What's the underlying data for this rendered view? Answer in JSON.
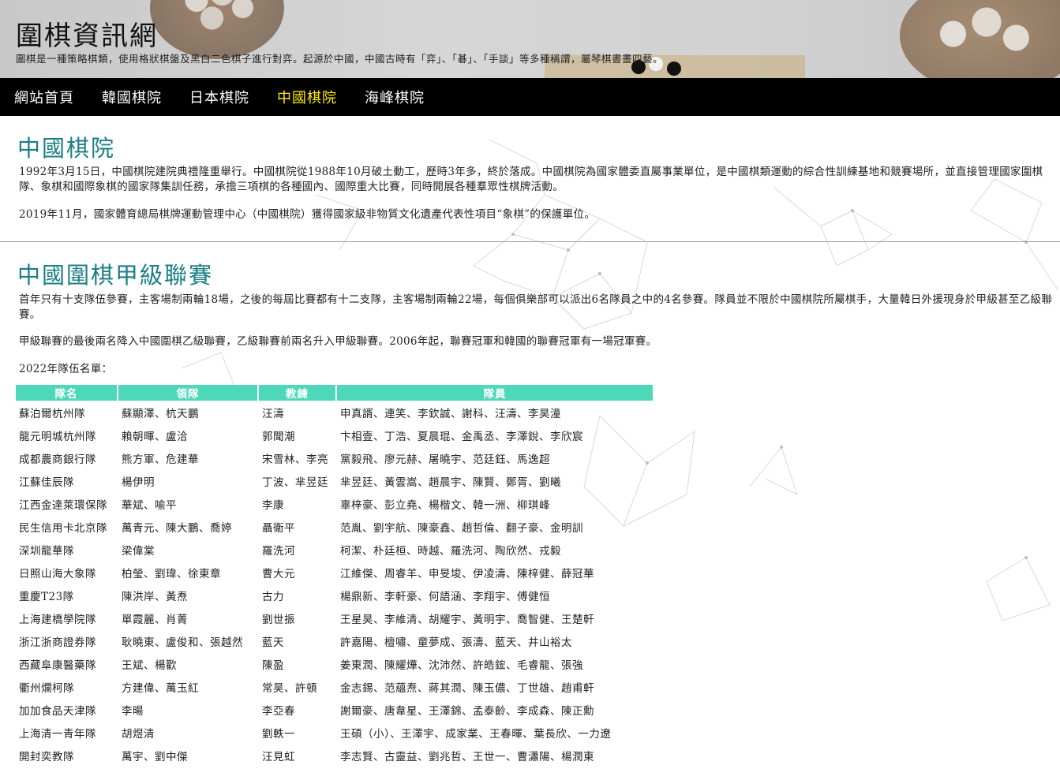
{
  "header": {
    "title": "圍棋資訊網",
    "description": "圍棋是一種策略棋類，使用格狀棋盤及黑白二色棋子進行對弈。起源於中國，中國古時有「弈」、「碁」、「手談」等多種稱謂，屬琴棋書畫四藝。"
  },
  "nav": {
    "items": [
      {
        "label": "網站首頁"
      },
      {
        "label": "韓國棋院"
      },
      {
        "label": "日本棋院"
      },
      {
        "label": "中國棋院"
      },
      {
        "label": "海峰棋院"
      }
    ],
    "active_index": 3
  },
  "section1": {
    "title": "中國棋院",
    "p1": "1992年3月15日，中國棋院建院典禮隆重舉行。中國棋院從1988年10月破土動工，歷時3年多，終於落成。中國棋院為國家體委直屬事業單位，是中國棋類運動的綜合性訓練基地和競賽場所，並直接管理國家圍棋隊、象棋和國際象棋的國家隊集訓任務，承擔三項棋的各種國內、國際重大比賽，同時開展各種羣眾性棋牌活動。",
    "p2": "2019年11月，國家體育總局棋牌運動管理中心（中國棋院）獲得國家級非物質文化遺產代表性項目“象棋”的保護單位。"
  },
  "section2": {
    "title": "中國圍棋甲級聯賽",
    "p1": "首年只有十支隊伍參賽，主客場制兩輪18場，之後的每屆比賽都有十二支隊，主客場制兩輪22場，每個俱樂部可以派出6名隊員之中的4名參賽。隊員並不限於中國棋院所屬棋手，大量韓日外援現身於甲級甚至乙級聯賽。",
    "p2": "甲級聯賽的最後兩名降入中國圍棋乙級聯賽，乙級聯賽前兩名升入甲級聯賽。2006年起，聯賽冠軍和韓國的聯賽冠軍有一場冠軍賽。",
    "roster_label": "2022年隊伍名單："
  },
  "table": {
    "headers": {
      "team": "隊名",
      "leader": "領隊",
      "coach": "教練",
      "players": "隊員"
    },
    "rows": [
      {
        "team": "蘇泊爾杭州隊",
        "leader": "蘇顯澤、杭天鵬",
        "coach": "汪濤",
        "players": "申真諝、連笑、李欽誠、謝科、汪濤、李昊潼"
      },
      {
        "team": "龍元明城杭州隊",
        "leader": "賴朝暉、盧洽",
        "coach": "郭聞潮",
        "players": "卞相壹、丁浩、夏晨琨、金禹丞、李澤銳、李欣宸"
      },
      {
        "team": "成都農商銀行隊",
        "leader": "熊方軍、危建華",
        "coach": "宋雪林、李亮",
        "players": "黨毅飛、廖元赫、屠曉宇、范廷鈺、馬逸超"
      },
      {
        "team": "江蘇佳辰隊",
        "leader": "楊伊明",
        "coach": "丁波、芈昱廷",
        "players": "芈昱廷、黃雲嵩、趙晨宇、陳賢、鄭胥、劉曦"
      },
      {
        "team": "江西金達萊環保隊",
        "leader": "華斌、喻平",
        "coach": "李康",
        "players": "辜梓豪、彭立堯、楊楷文、韓一洲、柳琪峰"
      },
      {
        "team": "民生信用卡北京隊",
        "leader": "萬青元、陳大鵬、喬婷",
        "coach": "聶衛平",
        "players": "范胤、劉宇航、陳豪鑫、趙哲倫、翻子豪、金明訓"
      },
      {
        "team": "深圳龍華隊",
        "leader": "梁偉棠",
        "coach": "羅洗河",
        "players": "柯潔、朴廷桓、時越、羅洗河、陶欣然、戎毅"
      },
      {
        "team": "日照山海大象隊",
        "leader": "柏瑩、劉瑋、徐東章",
        "coach": "曹大元",
        "players": "江維傑、周睿羊、申旻埈、伊凌濤、陳梓健、薛冠華"
      },
      {
        "team": "重慶T23隊",
        "leader": "陳洪岸、黃焘",
        "coach": "古力",
        "players": "楊鼎新、李軒豪、何語涵、李翔宇、傅健恒"
      },
      {
        "team": "上海建橋學院隊",
        "leader": "單霞麗、肖菁",
        "coach": "劉世振",
        "players": "王星昊、李維清、胡耀宇、黃明宇、喬智健、王楚軒"
      },
      {
        "team": "浙江浙商證券隊",
        "leader": "耿曉東、盧俊和、張越然",
        "coach": "藍天",
        "players": "許嘉陽、檀嘯、童夢成、張濤、藍天、井山裕太"
      },
      {
        "team": "西藏阜康醫藥隊",
        "leader": "王斌、楊歡",
        "coach": "陳盈",
        "players": "姜東潤、陳耀燁、沈沛然、許皓鋐、毛睿龍、張強"
      },
      {
        "team": "衢州爛柯隊",
        "leader": "方建偉、萬玉紅",
        "coach": "常昊、許頓",
        "players": "金志錫、范蘊焘、蔣其潤、陳玉儂、丁世雄、趙甫軒"
      },
      {
        "team": "加加食品天津隊",
        "leader": "李暘",
        "coach": "李亞春",
        "players": "謝爾豪、唐韋星、王澤錦、孟泰齡、李成森、陳正勳"
      },
      {
        "team": "上海清一青年隊",
        "leader": "胡煜清",
        "coach": "劉軼一",
        "players": "王碩（小）、王澤宇、成家業、王春暉、葉長欣、一力遼"
      },
      {
        "team": "開封奕教隊",
        "leader": "萬宇、劉中傑",
        "coach": "汪見虹",
        "players": "李志賢、古靈益、劉兆哲、王世一、曹瀟陽、楊潤東"
      }
    ]
  },
  "colors": {
    "nav_bg": "#000000",
    "nav_active": "#ffea00",
    "section_title": "#1a7f86",
    "table_header_bg": "#4dd9b9"
  }
}
